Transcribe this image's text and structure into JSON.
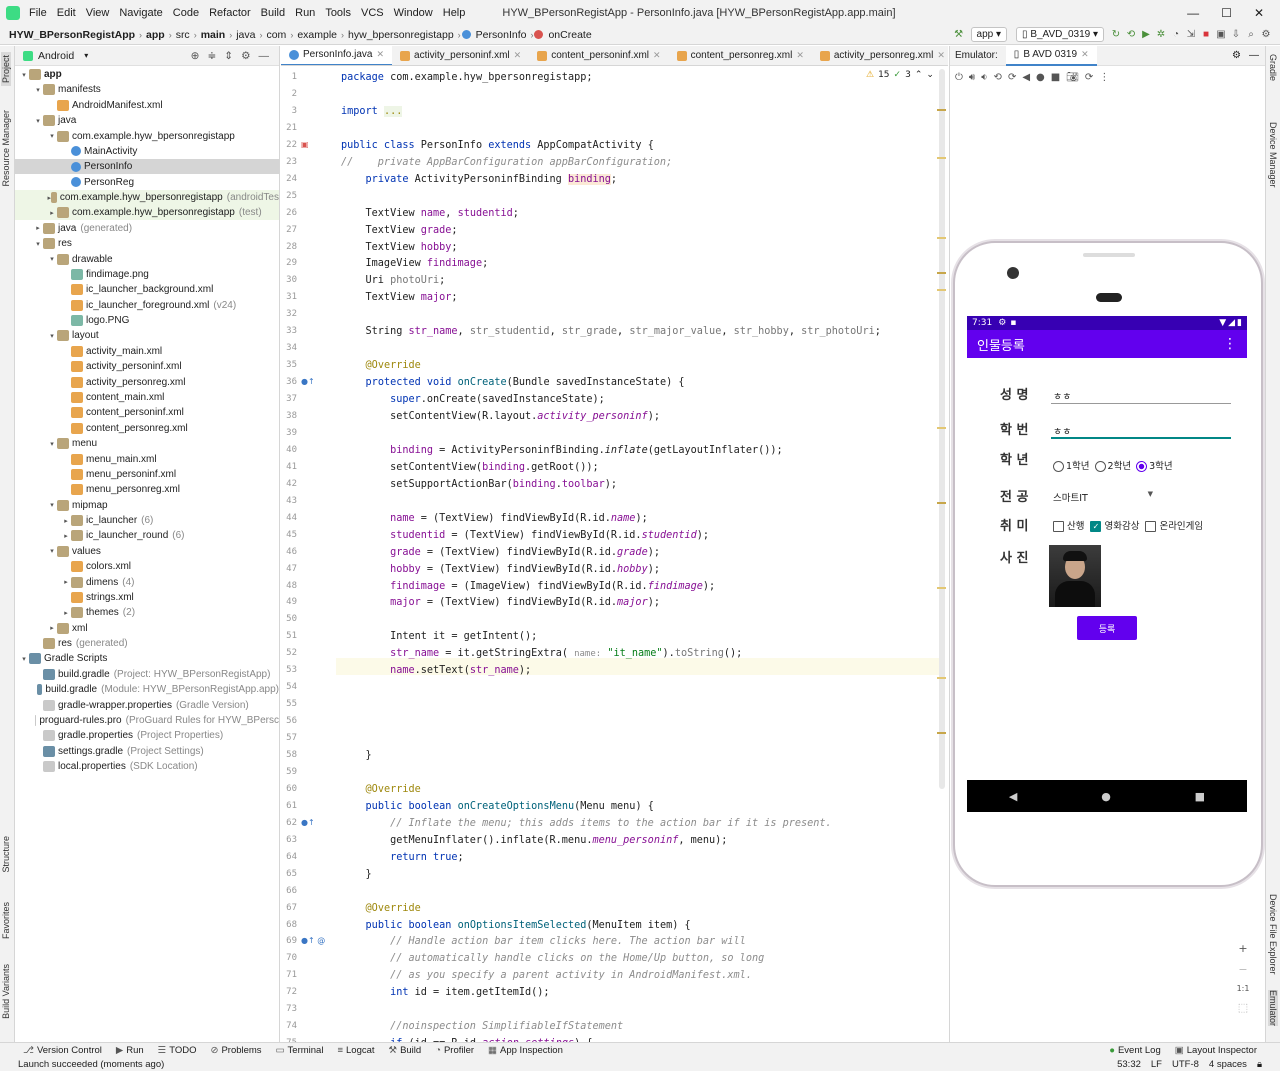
{
  "menubar": {
    "items": [
      "File",
      "Edit",
      "View",
      "Navigate",
      "Code",
      "Refactor",
      "Build",
      "Run",
      "Tools",
      "VCS",
      "Window",
      "Help"
    ],
    "title": "HYW_BPersonRegistApp - PersonInfo.java [HYW_BPersonRegistApp.app.main]"
  },
  "navbar": {
    "crumbs": [
      "HYW_BPersonRegistApp",
      "app",
      "src",
      "main",
      "java",
      "com",
      "example",
      "hyw_bpersonregistapp",
      "PersonInfo",
      "onCreate"
    ],
    "run_config": "app",
    "device": "B_AVD_0319"
  },
  "sidebar_left": {
    "project": "Project",
    "resource_manager": "Resource Manager",
    "structure": "Structure",
    "favorites": "Favorites",
    "build_variants": "Build Variants"
  },
  "sidebar_right": {
    "gradle": "Gradle",
    "device_manager": "Device Manager",
    "device_file_explorer": "Device File Explorer",
    "emulator": "Emulator"
  },
  "project": {
    "view": "Android",
    "tree": [
      {
        "label": "app",
        "sub": "",
        "icon": "folder",
        "depth": 0,
        "arrow": "▾",
        "bold": true
      },
      {
        "label": "manifests",
        "sub": "",
        "icon": "folder",
        "depth": 1,
        "arrow": "▾"
      },
      {
        "label": "AndroidManifest.xml",
        "sub": "",
        "icon": "xml",
        "depth": 2,
        "arrow": ""
      },
      {
        "label": "java",
        "sub": "",
        "icon": "folder",
        "depth": 1,
        "arrow": "▾"
      },
      {
        "label": "com.example.hyw_bpersonregistapp",
        "sub": "",
        "icon": "folder",
        "depth": 2,
        "arrow": "▾"
      },
      {
        "label": "MainActivity",
        "sub": "",
        "icon": "java",
        "depth": 3,
        "arrow": ""
      },
      {
        "label": "PersonInfo",
        "sub": "",
        "icon": "java",
        "depth": 3,
        "arrow": "",
        "sel": true
      },
      {
        "label": "PersonReg",
        "sub": "",
        "icon": "java",
        "depth": 3,
        "arrow": ""
      },
      {
        "label": "com.example.hyw_bpersonregistapp",
        "sub": "(androidTes",
        "icon": "folder",
        "depth": 2,
        "arrow": "▸",
        "green": true
      },
      {
        "label": "com.example.hyw_bpersonregistapp",
        "sub": "(test)",
        "icon": "folder",
        "depth": 2,
        "arrow": "▸",
        "green": true
      },
      {
        "label": "java",
        "sub": "(generated)",
        "icon": "folder",
        "depth": 1,
        "arrow": "▸"
      },
      {
        "label": "res",
        "sub": "",
        "icon": "folder",
        "depth": 1,
        "arrow": "▾"
      },
      {
        "label": "drawable",
        "sub": "",
        "icon": "folder",
        "depth": 2,
        "arrow": "▾"
      },
      {
        "label": "findimage.png",
        "sub": "",
        "icon": "img",
        "depth": 3,
        "arrow": ""
      },
      {
        "label": "ic_launcher_background.xml",
        "sub": "",
        "icon": "xml",
        "depth": 3,
        "arrow": ""
      },
      {
        "label": "ic_launcher_foreground.xml",
        "sub": "(v24)",
        "icon": "xml",
        "depth": 3,
        "arrow": ""
      },
      {
        "label": "logo.PNG",
        "sub": "",
        "icon": "img",
        "depth": 3,
        "arrow": ""
      },
      {
        "label": "layout",
        "sub": "",
        "icon": "folder",
        "depth": 2,
        "arrow": "▾"
      },
      {
        "label": "activity_main.xml",
        "sub": "",
        "icon": "xml",
        "depth": 3,
        "arrow": ""
      },
      {
        "label": "activity_personinf.xml",
        "sub": "",
        "icon": "xml",
        "depth": 3,
        "arrow": ""
      },
      {
        "label": "activity_personreg.xml",
        "sub": "",
        "icon": "xml",
        "depth": 3,
        "arrow": ""
      },
      {
        "label": "content_main.xml",
        "sub": "",
        "icon": "xml",
        "depth": 3,
        "arrow": ""
      },
      {
        "label": "content_personinf.xml",
        "sub": "",
        "icon": "xml",
        "depth": 3,
        "arrow": ""
      },
      {
        "label": "content_personreg.xml",
        "sub": "",
        "icon": "xml",
        "depth": 3,
        "arrow": ""
      },
      {
        "label": "menu",
        "sub": "",
        "icon": "folder",
        "depth": 2,
        "arrow": "▾"
      },
      {
        "label": "menu_main.xml",
        "sub": "",
        "icon": "xml",
        "depth": 3,
        "arrow": ""
      },
      {
        "label": "menu_personinf.xml",
        "sub": "",
        "icon": "xml",
        "depth": 3,
        "arrow": ""
      },
      {
        "label": "menu_personreg.xml",
        "sub": "",
        "icon": "xml",
        "depth": 3,
        "arrow": ""
      },
      {
        "label": "mipmap",
        "sub": "",
        "icon": "folder",
        "depth": 2,
        "arrow": "▾"
      },
      {
        "label": "ic_launcher",
        "sub": "(6)",
        "icon": "folder",
        "depth": 3,
        "arrow": "▸"
      },
      {
        "label": "ic_launcher_round",
        "sub": "(6)",
        "icon": "folder",
        "depth": 3,
        "arrow": "▸"
      },
      {
        "label": "values",
        "sub": "",
        "icon": "folder",
        "depth": 2,
        "arrow": "▾"
      },
      {
        "label": "colors.xml",
        "sub": "",
        "icon": "xml",
        "depth": 3,
        "arrow": ""
      },
      {
        "label": "dimens",
        "sub": "(4)",
        "icon": "folder",
        "depth": 3,
        "arrow": "▸"
      },
      {
        "label": "strings.xml",
        "sub": "",
        "icon": "xml",
        "depth": 3,
        "arrow": ""
      },
      {
        "label": "themes",
        "sub": "(2)",
        "icon": "folder",
        "depth": 3,
        "arrow": "▸"
      },
      {
        "label": "xml",
        "sub": "",
        "icon": "folder",
        "depth": 2,
        "arrow": "▸"
      },
      {
        "label": "res",
        "sub": "(generated)",
        "icon": "folder",
        "depth": 1,
        "arrow": ""
      },
      {
        "label": "Gradle Scripts",
        "sub": "",
        "icon": "gradle",
        "depth": 0,
        "arrow": "▾"
      },
      {
        "label": "build.gradle",
        "sub": "(Project: HYW_BPersonRegistApp)",
        "icon": "gradle",
        "depth": 1,
        "arrow": ""
      },
      {
        "label": "build.gradle",
        "sub": "(Module: HYW_BPersonRegistApp.app)",
        "icon": "gradle",
        "depth": 1,
        "arrow": ""
      },
      {
        "label": "gradle-wrapper.properties",
        "sub": "(Gradle Version)",
        "icon": "file",
        "depth": 1,
        "arrow": ""
      },
      {
        "label": "proguard-rules.pro",
        "sub": "(ProGuard Rules for HYW_BPersc",
        "icon": "file",
        "depth": 1,
        "arrow": ""
      },
      {
        "label": "gradle.properties",
        "sub": "(Project Properties)",
        "icon": "file",
        "depth": 1,
        "arrow": ""
      },
      {
        "label": "settings.gradle",
        "sub": "(Project Settings)",
        "icon": "gradle",
        "depth": 1,
        "arrow": ""
      },
      {
        "label": "local.properties",
        "sub": "(SDK Location)",
        "icon": "file",
        "depth": 1,
        "arrow": ""
      }
    ]
  },
  "tabs": [
    {
      "label": "PersonInfo.java",
      "icon": "java",
      "active": true
    },
    {
      "label": "activity_personinf.xml",
      "icon": "xml"
    },
    {
      "label": "content_personinf.xml",
      "icon": "xml"
    },
    {
      "label": "content_personreg.xml",
      "icon": "xml"
    },
    {
      "label": "activity_personreg.xml",
      "icon": "xml"
    }
  ],
  "inspections": {
    "warnings": "15",
    "ok": "3"
  },
  "code": [
    {
      "n": "1",
      "h": "<span class='kw'>package</span> com.example.hyw_bpersonregistapp;"
    },
    {
      "n": "2",
      "h": ""
    },
    {
      "n": "3",
      "h": "<span class='kw'>import</span> <span class='an' style='background:#eef5e6'>...</span>"
    },
    {
      "n": "21",
      "h": ""
    },
    {
      "n": "22",
      "h": "<span class='kw'>public class</span> PersonInfo <span class='kw'>extends</span> AppCompatActivity {"
    },
    {
      "n": "23",
      "h": "<span class='cm'>//    private AppBarConfiguration appBarConfiguration;</span>"
    },
    {
      "n": "24",
      "h": "    <span class='kw'>private</span> ActivityPersoninfBinding <span class='fd' style='background:#fbe9d6'>binding</span>;"
    },
    {
      "n": "25",
      "h": ""
    },
    {
      "n": "26",
      "h": "    TextView <span class='fd'>name</span>, <span class='fd'>studentid</span>;"
    },
    {
      "n": "27",
      "h": "    TextView <span class='fd'>grade</span>;"
    },
    {
      "n": "28",
      "h": "    TextView <span class='fd'>hobby</span>;"
    },
    {
      "n": "29",
      "h": "    ImageView <span class='fd'>findimage</span>;"
    },
    {
      "n": "30",
      "h": "    Uri <span class='fd' style='color:#777'>photoUri</span>;"
    },
    {
      "n": "31",
      "h": "    TextView <span class='fd'>major</span>;"
    },
    {
      "n": "32",
      "h": ""
    },
    {
      "n": "33",
      "h": "    String <span class='fd'>str_name</span>, <span class='fd' style='color:#777'>str_studentid</span>, <span class='fd' style='color:#777'>str_grade</span>, <span class='fd' style='color:#777'>str_major_value</span>, <span class='fd' style='color:#777'>str_hobby</span>, <span class='fd' style='color:#777'>str_photoUri</span>;"
    },
    {
      "n": "34",
      "h": ""
    },
    {
      "n": "35",
      "h": "    <span class='an'>@Override</span>"
    },
    {
      "n": "36",
      "h": "    <span class='kw'>protected void</span> <span class='mt'>onCreate</span>(Bundle savedInstanceState) {"
    },
    {
      "n": "37",
      "h": "        <span class='kw'>super</span>.onCreate(savedInstanceState);"
    },
    {
      "n": "38",
      "h": "        setContentView(R.layout.<span class='fd it'>activity_personinf</span>);"
    },
    {
      "n": "39",
      "h": ""
    },
    {
      "n": "40",
      "h": "        <span class='fd'>binding</span> = ActivityPersoninfBinding.<span class='it'>inflate</span>(getLayoutInflater());"
    },
    {
      "n": "41",
      "h": "        setContentView(<span class='fd'>binding</span>.getRoot());"
    },
    {
      "n": "42",
      "h": "        setSupportActionBar(<span class='fd'>binding</span>.<span class='fd'>toolbar</span>);"
    },
    {
      "n": "43",
      "h": ""
    },
    {
      "n": "44",
      "h": "        <span class='fd'>name</span> = (TextView) findViewById(R.id.<span class='fd it'>name</span>);"
    },
    {
      "n": "45",
      "h": "        <span class='fd'>studentid</span> = (TextView) findViewById(R.id.<span class='fd it'>studentid</span>);"
    },
    {
      "n": "46",
      "h": "        <span class='fd'>grade</span> = (TextView) findViewById(R.id.<span class='fd it'>grade</span>);"
    },
    {
      "n": "47",
      "h": "        <span class='fd'>hobby</span> = (TextView) findViewById(R.id.<span class='fd it'>hobby</span>);"
    },
    {
      "n": "48",
      "h": "        <span class='fd'>findimage</span> = (ImageView) findViewById(R.id.<span class='fd it'>findimage</span>);"
    },
    {
      "n": "49",
      "h": "        <span class='fd'>major</span> = (TextView) findViewById(R.id.<span class='fd it'>major</span>);"
    },
    {
      "n": "50",
      "h": ""
    },
    {
      "n": "51",
      "h": "        Intent it = getIntent();"
    },
    {
      "n": "52",
      "h": "        <span class='fd'>str_name</span> = it.getStringExtra( <span class='hint'>name:</span> <span class='st'>\"it_name\"</span>).<span style='color:#777'>toString</span>();"
    },
    {
      "n": "53",
      "h": "        <span class='fd'>name</span>.setText(<span class='fd'>str_name</span>);"
    },
    {
      "n": "54",
      "h": ""
    },
    {
      "n": "55",
      "h": ""
    },
    {
      "n": "56",
      "h": ""
    },
    {
      "n": "57",
      "h": ""
    },
    {
      "n": "58",
      "h": "    }"
    },
    {
      "n": "59",
      "h": ""
    },
    {
      "n": "60",
      "h": "    <span class='an'>@Override</span>"
    },
    {
      "n": "61",
      "h": "    <span class='kw'>public boolean</span> <span class='mt'>onCreateOptionsMenu</span>(Menu menu) {"
    },
    {
      "n": "62",
      "h": "        <span class='cm'>// Inflate the menu; this adds items to the action bar if it is present.</span>"
    },
    {
      "n": "63",
      "h": "        getMenuInflater().inflate(R.menu.<span class='fd it'>menu_personinf</span>, menu);"
    },
    {
      "n": "64",
      "h": "        <span class='kw'>return true</span>;"
    },
    {
      "n": "65",
      "h": "    }"
    },
    {
      "n": "66",
      "h": ""
    },
    {
      "n": "67",
      "h": "    <span class='an'>@Override</span>"
    },
    {
      "n": "68",
      "h": "    <span class='kw'>public boolean</span> <span class='mt'>onOptionsItemSelected</span>(MenuItem item) {"
    },
    {
      "n": "69",
      "h": "        <span class='cm'>// Handle action bar item clicks here. The action bar will</span>"
    },
    {
      "n": "70",
      "h": "        <span class='cm'>// automatically handle clicks on the Home/Up button, so long</span>"
    },
    {
      "n": "71",
      "h": "        <span class='cm'>// as you specify a parent activity in AndroidManifest.xml.</span>"
    },
    {
      "n": "72",
      "h": "        <span class='kw'>int</span> id = item.getItemId();"
    },
    {
      "n": "73",
      "h": ""
    },
    {
      "n": "74",
      "h": "        <span class='cm'>//noinspection SimplifiableIfStatement</span>"
    },
    {
      "n": "75",
      "h": "        <span class='kw'>if</span> (id == R.id.<span class='fd it'>action_settings</span>) {"
    }
  ],
  "emulator": {
    "title": "Emulator:",
    "device_tab": "B AVD 0319",
    "status_time": "7:31",
    "app_title": "인물등록",
    "labels": {
      "name": "성 명",
      "studentid": "학 번",
      "grade": "학 년",
      "major": "전 공",
      "hobby": "취 미",
      "photo": "사 진"
    },
    "name_value": "ㅎㅎ",
    "studentid_value": "ㅎㅎ",
    "grades": [
      {
        "label": "1학년",
        "on": false
      },
      {
        "label": "2학년",
        "on": false
      },
      {
        "label": "3학년",
        "on": true
      }
    ],
    "major_value": "스마트IT",
    "hobbies": [
      {
        "label": "산행",
        "on": false
      },
      {
        "label": "영화감상",
        "on": true
      },
      {
        "label": "온라인게임",
        "on": false
      }
    ],
    "register_button": "등록",
    "zoom_fit": "1:1"
  },
  "bottom_tools": [
    "Version Control",
    "Run",
    "TODO",
    "Problems",
    "Terminal",
    "Logcat",
    "Build",
    "Profiler",
    "App Inspection"
  ],
  "bottom_right_tools": [
    "Event Log",
    "Layout Inspector"
  ],
  "status": {
    "message": "Launch succeeded (moments ago)",
    "pos": "53:32",
    "eol": "LF",
    "enc": "UTF-8",
    "indent": "4 spaces"
  },
  "colors": {
    "accent": "#6200ee",
    "status_bar": "#3700b3",
    "checkbox": "#018786"
  }
}
